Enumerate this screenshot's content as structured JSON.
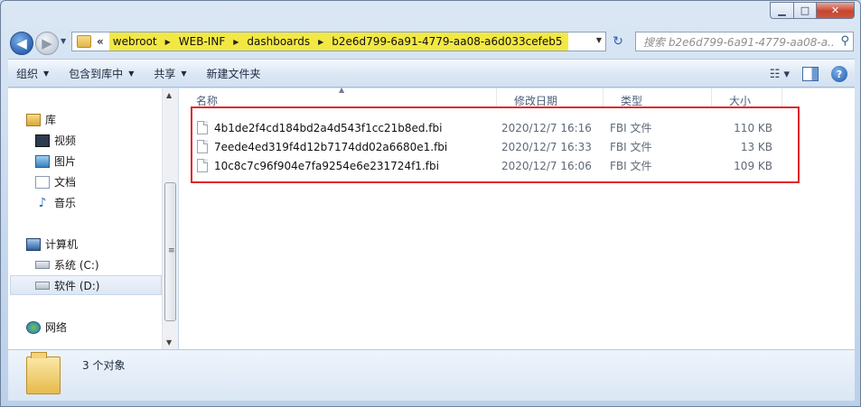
{
  "window": {
    "caption_min": "▁",
    "caption_max": "□",
    "caption_close": "✕"
  },
  "nav": {
    "back_glyph": "◀",
    "forward_glyph": "▶",
    "history_glyph": "▼"
  },
  "address": {
    "overflow_glyph": "«",
    "crumbs": [
      "webroot",
      "WEB-INF",
      "dashboards",
      "b2e6d799-6a91-4779-aa08-a6d033cefeb5"
    ],
    "separator_glyph": "▶",
    "dropdown_glyph": "▼",
    "highlight_color": "#f3e843"
  },
  "refresh_glyph": "↻",
  "search": {
    "placeholder": "搜索 b2e6d799-6a91-4779-aa08-a...",
    "icon_glyph": "⚲"
  },
  "toolbar": {
    "organize": "组织",
    "include_in_library": "包含到库中",
    "share": "共享",
    "new_folder": "新建文件夹",
    "dropdown_glyph": "▼",
    "views_glyph": "☷ ▾",
    "help_glyph": "?"
  },
  "navpane": {
    "libraries": "库",
    "videos": "视频",
    "pictures": "图片",
    "documents": "文档",
    "music": "音乐",
    "computer": "计算机",
    "drive_c": "系统 (C:)",
    "drive_d": "软件 (D:)",
    "network": "网络",
    "music_glyph": "♪"
  },
  "scroll": {
    "up_glyph": "▲",
    "down_glyph": "▼",
    "grip_glyph": "≡"
  },
  "columns": {
    "name": "名称",
    "date": "修改日期",
    "type": "类型",
    "size": "大小",
    "sort_glyph": "▲"
  },
  "files": [
    {
      "name": "4b1de2f4cd184bd2a4d543f1cc21b8ed.fbi",
      "date": "2020/12/7 16:16",
      "type": "FBI 文件",
      "size": "110 KB"
    },
    {
      "name": "7eede4ed319f4d12b7174dd02a6680e1.fbi",
      "date": "2020/12/7 16:33",
      "type": "FBI 文件",
      "size": "13 KB"
    },
    {
      "name": "10c8c7c96f904e7fa9254e6e231724f1.fbi",
      "date": "2020/12/7 16:06",
      "type": "FBI 文件",
      "size": "109 KB"
    }
  ],
  "status": {
    "count_text": "3 个对象"
  },
  "annotation_color": "#e0262c"
}
